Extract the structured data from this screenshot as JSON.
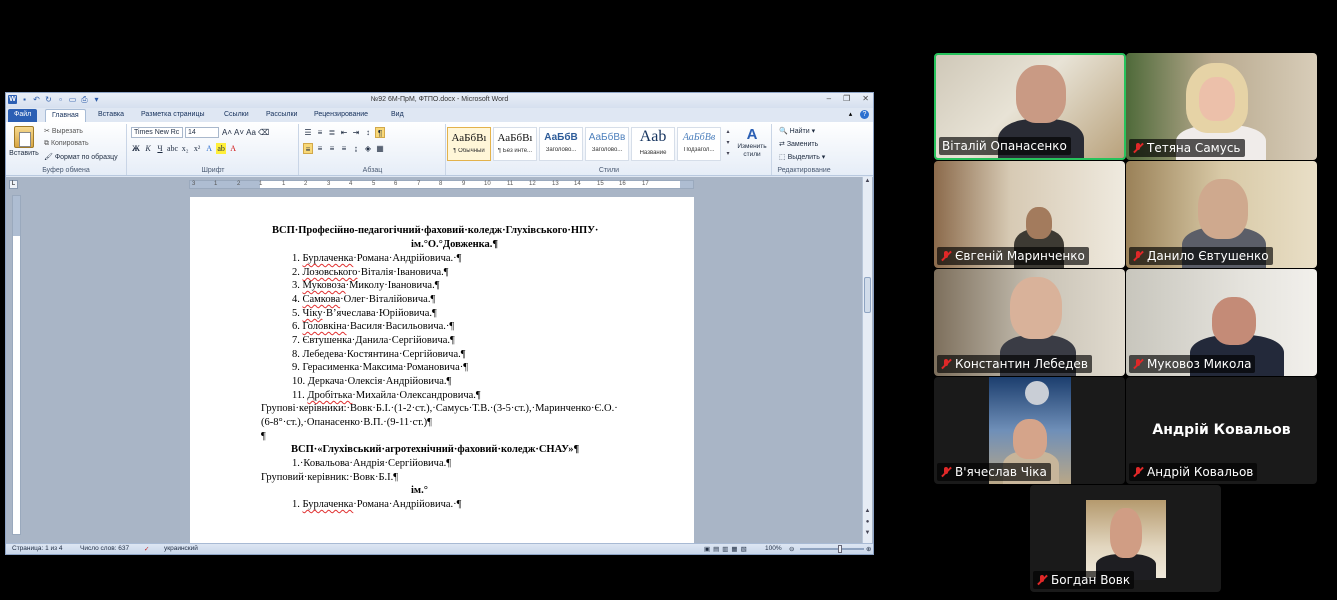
{
  "word": {
    "title": "№92 6М-ПрМ,  ФТПО.docx - Microsoft Word",
    "tabs": [
      "Файл",
      "Главная",
      "Вставка",
      "Разметка страницы",
      "Ссылки",
      "Рассылки",
      "Рецензирование",
      "Вид"
    ],
    "ribbon": {
      "paste": "Вставить",
      "cut": "Вырезать",
      "copy": "Копировать",
      "format_painter": "Формат по образцу",
      "clipboard_group": "Буфер обмена",
      "font_name": "Times New Rc",
      "font_size": "14",
      "font_group": "Шрифт",
      "paragraph_group": "Абзац",
      "styles_group": "Стили",
      "styles": [
        {
          "sample": "АаБбВı",
          "name": "¶ Обычный"
        },
        {
          "sample": "АаБбВı",
          "name": "¶ Без инте..."
        },
        {
          "sample": "АаБбВ",
          "name": "Заголово..."
        },
        {
          "sample": "АаБбВв",
          "name": "Заголово..."
        },
        {
          "sample": "Aab",
          "name": "Название"
        },
        {
          "sample": "АаБбВв",
          "name": "Подзагол..."
        }
      ],
      "change_styles": "Изменить стили",
      "find": "Найти",
      "replace": "Заменить",
      "select": "Выделить",
      "editing_group": "Редактирование"
    },
    "ruler_numbers": [
      "3",
      "1",
      "2",
      "1",
      "1",
      "2",
      "3",
      "4",
      "5",
      "6",
      "7",
      "8",
      "9",
      "10",
      "11",
      "12",
      "13",
      "14",
      "15",
      "16",
      "17"
    ],
    "document": {
      "heading1_a": "ВСП·Професійно-педагогічний·фаховий·коледж·Глухівського·НПУ·",
      "heading1_b": "ім.°О.°Довженка.¶",
      "list1": [
        {
          "num": "1.",
          "sq": "Бурлаченка",
          "rest": "·Романа·Андрійовича.·¶"
        },
        {
          "num": "2.",
          "sq": "Лозовського",
          "rest": "·Віталія·Івановича.¶"
        },
        {
          "num": "3.",
          "sq": "Муковоза",
          "rest": "·Миколу·Івановича.¶"
        },
        {
          "num": "4.",
          "sq": "Самкова",
          "rest": "·Олег·Віталійовича.¶"
        },
        {
          "num": "5.",
          "sq": "Чіку",
          "rest": "·В’ячеслава·Юрійовича.¶"
        },
        {
          "num": "6.",
          "sq": "Головкіна",
          "rest": "·Василя·Васильовича.·¶"
        },
        {
          "num": "7.",
          "sq": "",
          "rest": "Євтушенка·Данила·Сергійовича.¶"
        },
        {
          "num": "8.",
          "sq": "",
          "rest": "Лебедева·Костянтина·Сергійовича.¶"
        },
        {
          "num": "9.",
          "sq": "",
          "rest": "Герасименка·Максима·Романовича·¶"
        },
        {
          "num": "10.",
          "sq": "",
          "rest": "Деркача·Олексія·Андрійовича.¶"
        },
        {
          "num": "11.",
          "sq": "Дробітька",
          "rest": "·Михайла·Олександровича.¶"
        }
      ],
      "leaders_a": "Групові·керівники:·Вовк·Б.І.·(1-2·ст.),·Самусь·Т.В.·(3-5·ст.),·Маринченко·Є.О.·",
      "leaders_b": "(6-8°·ст.),·Опанасенко·В.П.·(9-11·ст.)¶",
      "empty": "¶",
      "heading2": "ВСП·«Глухівський·агротехнічний·фаховий·коледж·СНАУ»¶",
      "list2_item": "1.·Ковальова·Андрія·Сергійовича.¶",
      "leader2": "Груповий·керівник:·Вовк·Б.І.¶",
      "partial": "ім.°",
      "list3_num": "1.",
      "list3_sq": "Бурлаченка",
      "list3_rest": "·Романа·Андрійовича.·¶"
    },
    "status": {
      "page": "Страница: 1 из 4",
      "words": "Число слов: 637",
      "lang": "украинский",
      "zoom": "100%"
    }
  },
  "participants": [
    {
      "name": "Віталій Опанасенко",
      "active": true,
      "muted": false
    },
    {
      "name": "Тетяна Самусь",
      "active": false,
      "muted": true
    },
    {
      "name": "Євгеній Маринченко",
      "active": false,
      "muted": true
    },
    {
      "name": "Данило Євтушенко",
      "active": false,
      "muted": true
    },
    {
      "name": "Константин Лебедев",
      "active": false,
      "muted": true
    },
    {
      "name": "Муковоз Микола",
      "active": false,
      "muted": true
    },
    {
      "name": "В'ячеслав Чіка",
      "active": false,
      "muted": true
    },
    {
      "name": "Андрій Ковальов",
      "active": false,
      "muted": true,
      "no_video_label": "Андрій Ковальов"
    },
    {
      "name": "Богдан Вовк",
      "active": false,
      "muted": true
    }
  ],
  "colors": {
    "active_speaker_border": "#27c25c",
    "muted_icon": "#e02828",
    "word_accent": "#2b5fb4"
  }
}
